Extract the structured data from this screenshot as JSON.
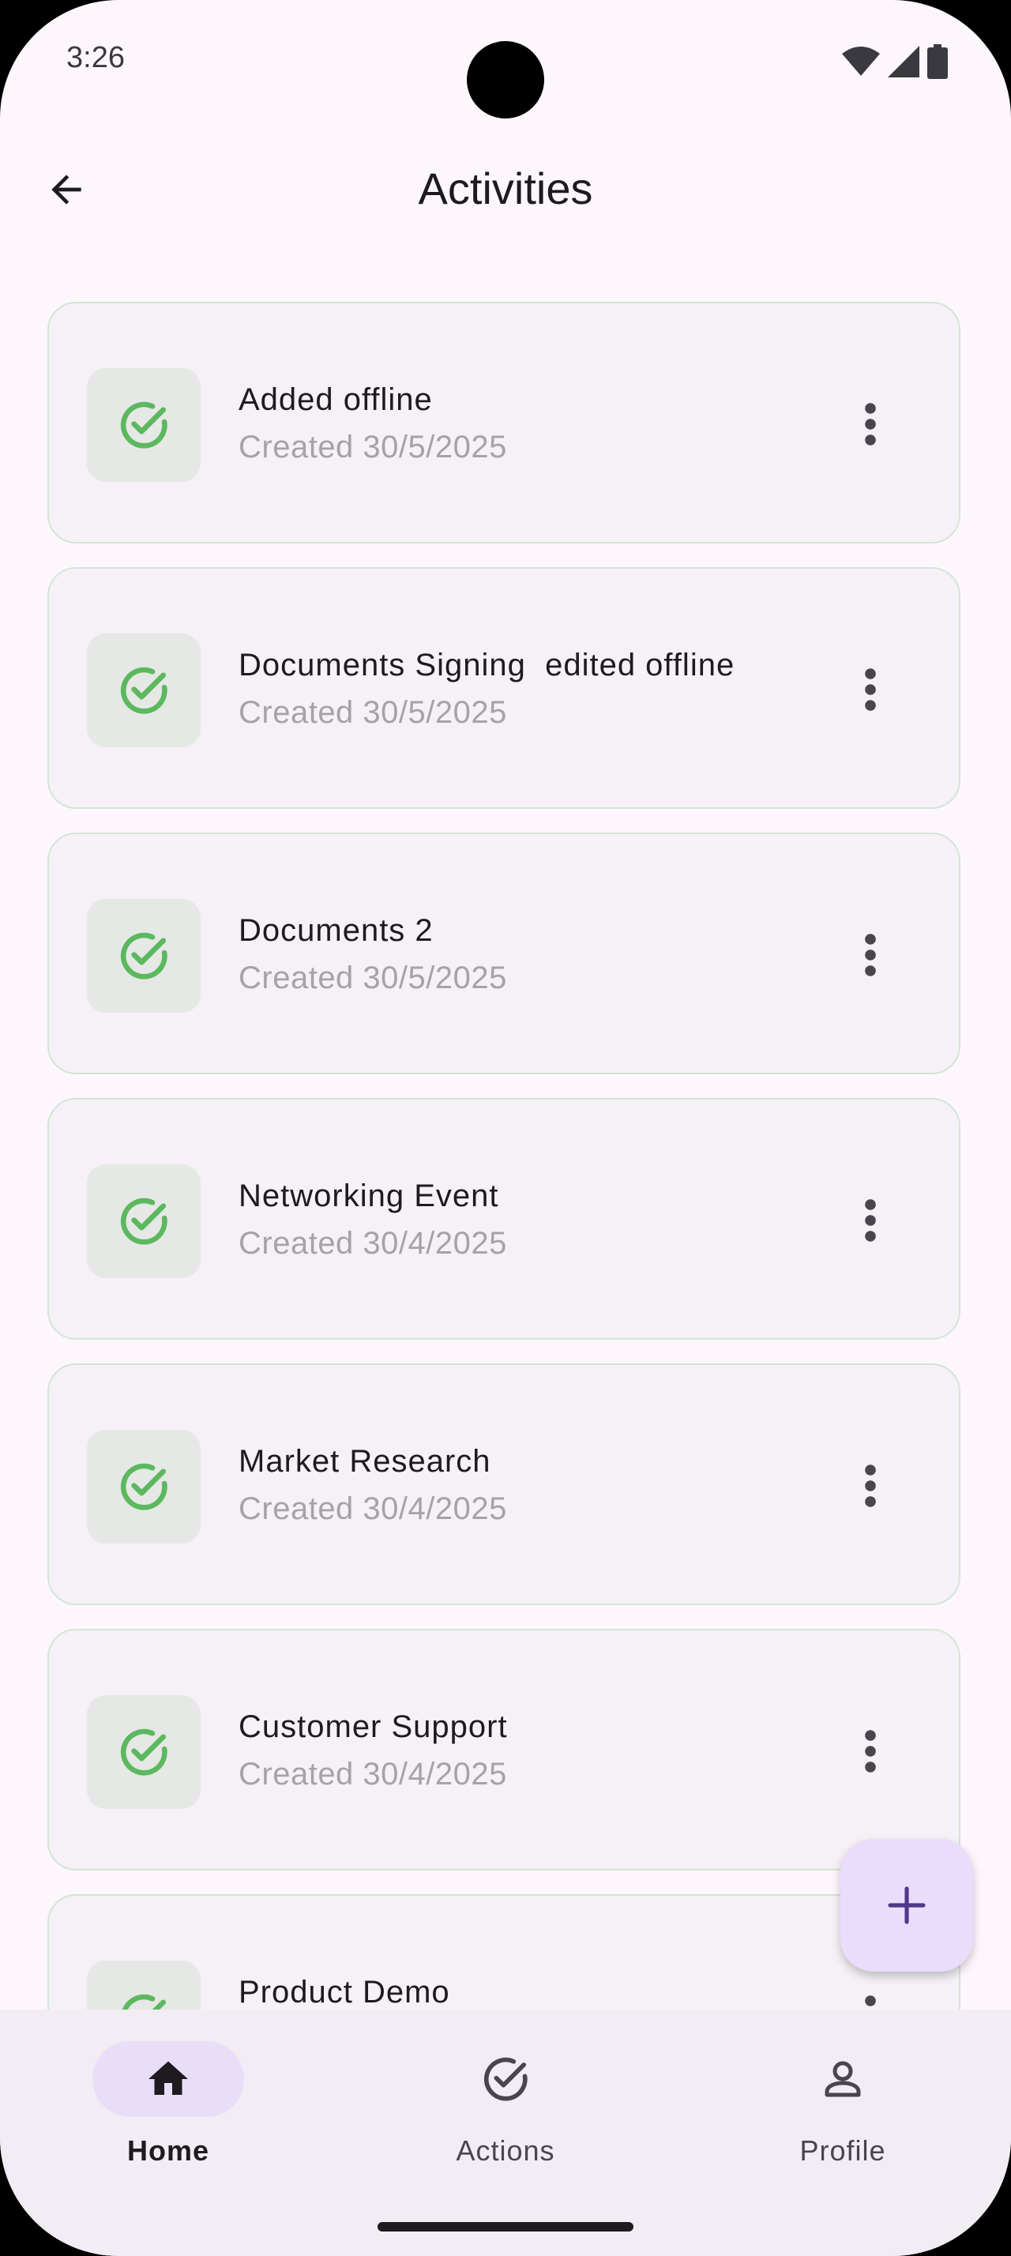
{
  "status_bar": {
    "time": "3:26"
  },
  "app_bar": {
    "title": "Activities"
  },
  "activities": [
    {
      "title": "Added offline",
      "subtitle": "Created 30/5/2025"
    },
    {
      "title": "Documents Signing  edited offline",
      "subtitle": "Created 30/5/2025"
    },
    {
      "title": "Documents 2",
      "subtitle": "Created 30/5/2025"
    },
    {
      "title": "Networking Event",
      "subtitle": "Created 30/4/2025"
    },
    {
      "title": "Market Research",
      "subtitle": "Created 30/4/2025"
    },
    {
      "title": "Customer Support",
      "subtitle": "Created 30/4/2025"
    },
    {
      "title": "Product Demo",
      "subtitle": ""
    }
  ],
  "bottom_nav": {
    "items": [
      {
        "label": "Home",
        "icon": "home-icon",
        "active": true
      },
      {
        "label": "Actions",
        "icon": "check-circle-icon",
        "active": false
      },
      {
        "label": "Profile",
        "icon": "person-icon",
        "active": false
      }
    ]
  },
  "colors": {
    "background": "#FDF7FD",
    "card": "#F5F1F6",
    "card_border": "#D4E4D7",
    "check_green": "#5CB85F",
    "accent": "#6750A4",
    "fab": "#EADDFB",
    "nav_active_pill": "#E8DEF8"
  }
}
